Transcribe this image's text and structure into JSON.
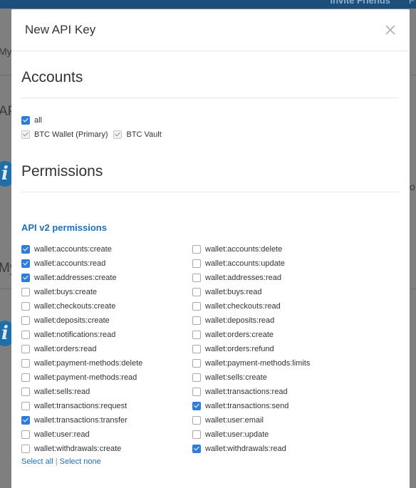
{
  "background": {
    "invite_text": "Invite Friends",
    "fragments": [
      "My",
      "AP",
      "My",
      "o"
    ]
  },
  "modal": {
    "title": "New API Key",
    "close_icon": "close-icon",
    "accounts_heading": "Accounts",
    "accounts": [
      {
        "label": "all",
        "checked": true,
        "disabled": false
      },
      {
        "label": "BTC Wallet (Primary)",
        "checked": true,
        "disabled": true
      },
      {
        "label": "BTC Vault",
        "checked": true,
        "disabled": true
      }
    ],
    "permissions_heading": "Permissions",
    "api_v2_title": "API v2 permissions",
    "permissions_left": [
      {
        "label": "wallet:accounts:create",
        "checked": true
      },
      {
        "label": "wallet:accounts:read",
        "checked": true
      },
      {
        "label": "wallet:addresses:create",
        "checked": true
      },
      {
        "label": "wallet:buys:create",
        "checked": false
      },
      {
        "label": "wallet:checkouts:create",
        "checked": false
      },
      {
        "label": "wallet:deposits:create",
        "checked": false
      },
      {
        "label": "wallet:notifications:read",
        "checked": false
      },
      {
        "label": "wallet:orders:read",
        "checked": false
      },
      {
        "label": "wallet:payment-methods:delete",
        "checked": false
      },
      {
        "label": "wallet:payment-methods:read",
        "checked": false
      },
      {
        "label": "wallet:sells:read",
        "checked": false
      },
      {
        "label": "wallet:transactions:request",
        "checked": false
      },
      {
        "label": "wallet:transactions:transfer",
        "checked": true
      },
      {
        "label": "wallet:user:read",
        "checked": false
      },
      {
        "label": "wallet:withdrawals:create",
        "checked": false
      }
    ],
    "permissions_right": [
      {
        "label": "wallet:accounts:delete",
        "checked": false
      },
      {
        "label": "wallet:accounts:update",
        "checked": false
      },
      {
        "label": "wallet:addresses:read",
        "checked": false
      },
      {
        "label": "wallet:buys:read",
        "checked": false
      },
      {
        "label": "wallet:checkouts:read",
        "checked": false
      },
      {
        "label": "wallet:deposits:read",
        "checked": false
      },
      {
        "label": "wallet:orders:create",
        "checked": false
      },
      {
        "label": "wallet:orders:refund",
        "checked": false
      },
      {
        "label": "wallet:payment-methods:limits",
        "checked": false
      },
      {
        "label": "wallet:sells:create",
        "checked": false
      },
      {
        "label": "wallet:transactions:read",
        "checked": false
      },
      {
        "label": "wallet:transactions:send",
        "checked": true
      },
      {
        "label": "wallet:user:email",
        "checked": false
      },
      {
        "label": "wallet:user:update",
        "checked": false
      },
      {
        "label": "wallet:withdrawals:read",
        "checked": true
      }
    ],
    "select_all": "Select all",
    "separator": "|",
    "select_none": "Select none"
  },
  "colors": {
    "accent": "#2f7ddb",
    "link": "#1f6fb9",
    "overlay": "#7f7f7f",
    "topbar": "#1d4f7c"
  }
}
